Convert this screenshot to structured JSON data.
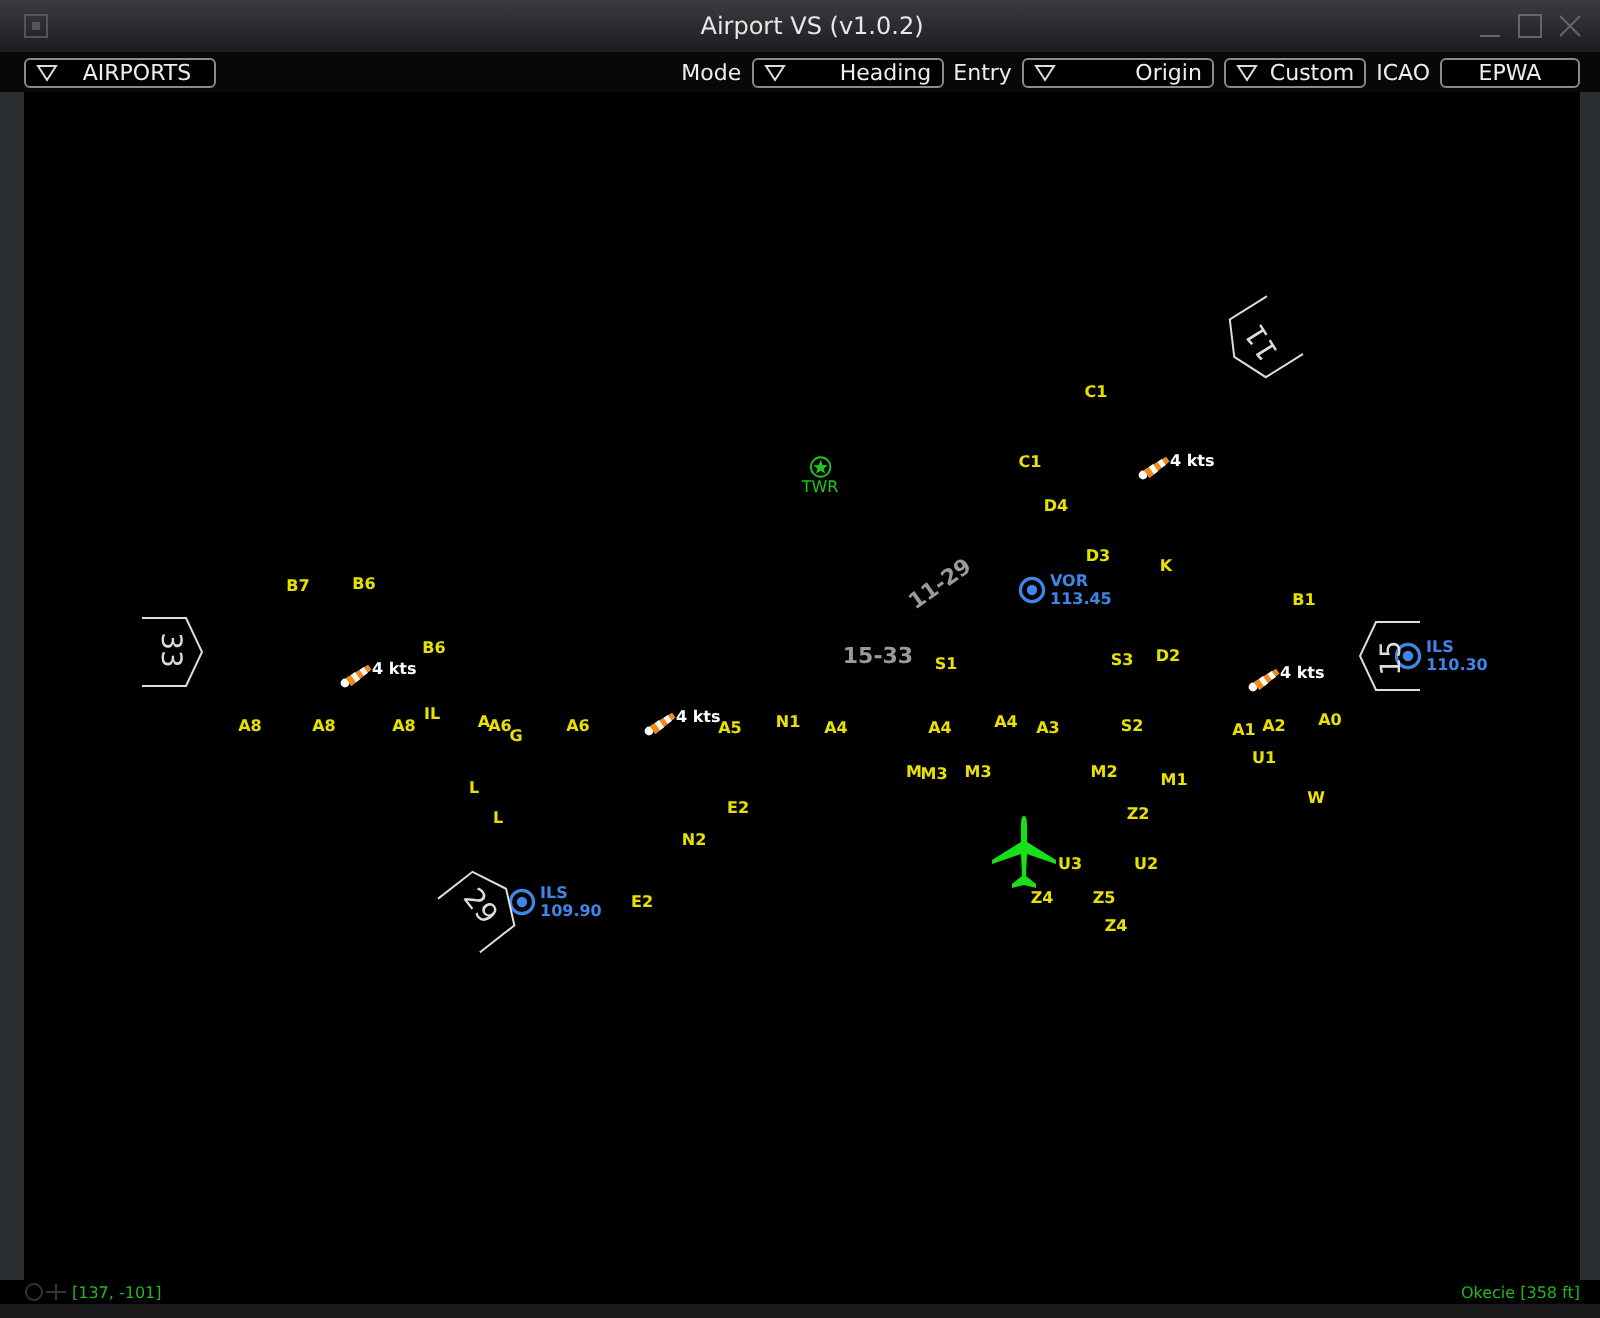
{
  "window": {
    "title": "Airport VS (v1.0.2)"
  },
  "toolbar": [
    {
      "kind": "dropdown",
      "value": "AIRPORTS"
    },
    {
      "kind": "label",
      "value": "Mode"
    },
    {
      "kind": "dropdown",
      "value": "Heading"
    },
    {
      "kind": "label",
      "value": "Entry"
    },
    {
      "kind": "dropdown",
      "value": "Origin"
    },
    {
      "kind": "dropdown",
      "value": "Custom"
    },
    {
      "kind": "label",
      "value": "ICAO"
    },
    {
      "kind": "field",
      "value": "EPWA"
    }
  ],
  "map": {
    "taxiways": [
      "C1",
      "C1",
      "D4",
      "D3",
      "K",
      "B1",
      "S3",
      "D2",
      "S1",
      "B7",
      "B6",
      "B6",
      "A8",
      "A8",
      "A8",
      "IL",
      "A",
      "A6",
      "G",
      "A6",
      "A5",
      "N1",
      "A4",
      "A4",
      "A4",
      "A3",
      "S2",
      "A1",
      "A2",
      "A0",
      "U1",
      "M",
      "M3",
      "M3",
      "M2",
      "M1",
      "W",
      "L",
      "L",
      "E2",
      "N2",
      "Z2",
      "U3",
      "U2",
      "Z4",
      "Z5",
      "Z4",
      "E2"
    ],
    "windsocks": [
      {
        "speed": "4 kts"
      },
      {
        "speed": "4 kts"
      },
      {
        "speed": "4 kts"
      },
      {
        "speed": "4 kts"
      }
    ],
    "navaids": [
      {
        "ident": "VOR",
        "freq": "113.45"
      },
      {
        "ident": "ILS",
        "freq": "109.90"
      },
      {
        "ident": "ILS",
        "freq": "110.30"
      }
    ],
    "tower": {
      "label": "TWR"
    },
    "runway_labels": [
      "11-29",
      "15-33"
    ],
    "runway_ends": [
      "33",
      "15",
      "11",
      "29"
    ]
  },
  "status_bar": {
    "cursor": "[137, -101]",
    "airport": "Okecie [358 ft]"
  }
}
